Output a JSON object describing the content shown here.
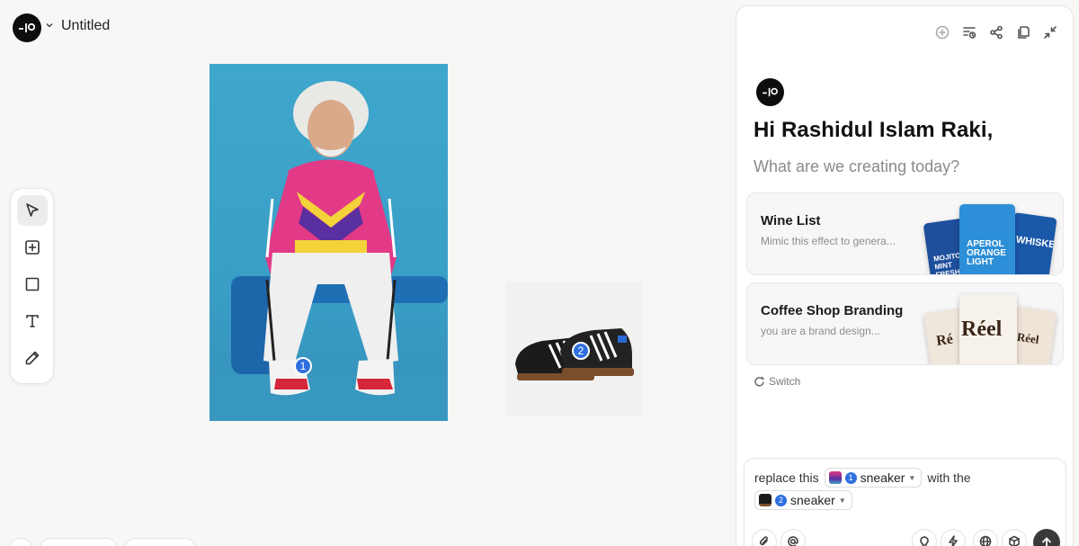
{
  "header": {
    "title": "Untitled"
  },
  "toolbar": {
    "tools": [
      "select-tool",
      "add-frame-tool",
      "rectangle-tool",
      "text-tool",
      "pen-tool"
    ],
    "active": "select-tool"
  },
  "canvas": {
    "images": [
      {
        "name": "photo-man-tracksuit",
        "badge": "1"
      },
      {
        "name": "photo-sneakers",
        "badge": "2"
      }
    ]
  },
  "panel": {
    "greeting": "Hi Rashidul Islam Raki,",
    "subtitle": "What are we creating today?",
    "cards": [
      {
        "title": "Wine List",
        "desc": "Mimic this effect to genera...",
        "thumbs": [
          "MOJITO MINT FRESH",
          "APEROL ORANGE LIGHT",
          "WHISKEY"
        ]
      },
      {
        "title": "Coffee Shop Branding",
        "desc": "you are a brand design...",
        "thumbs": [
          "Ré",
          "Réel",
          "Réel"
        ]
      }
    ],
    "switch_label": "Switch",
    "composer": {
      "text_before": "replace this",
      "mention1": {
        "badge": "1",
        "label": "sneaker"
      },
      "text_middle": "with the",
      "mention2": {
        "badge": "2",
        "label": "sneaker"
      }
    }
  },
  "colors": {
    "accent": "#2f6fe0",
    "photo_bg": "#3fa6cc",
    "send_button": "#3a3a3a"
  }
}
